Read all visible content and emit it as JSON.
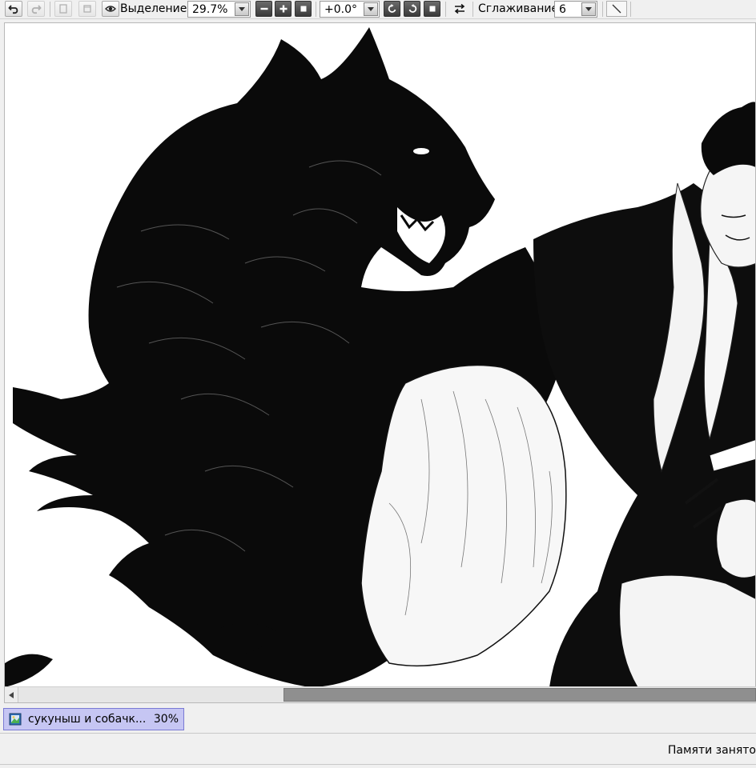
{
  "toolbar": {
    "selection_label": "Выделение",
    "zoom_value": "29.7%",
    "rotation_value": "+0.0°",
    "smoothing_label": "Сглаживание",
    "smoothing_value": "6"
  },
  "document_tab": {
    "name": "сукуныш и собачк...",
    "zoom": "30%"
  },
  "status": {
    "memory_label": "Памяти занято"
  },
  "colors": {
    "tab_active_bg": "#c6c6f3",
    "scroll_thumb": "#8f8f8f",
    "ink": "#000000"
  },
  "icons": [
    "undo-icon",
    "redo-icon",
    "page-icon",
    "view-eye-icon",
    "zoom-out-icon",
    "zoom-in-icon",
    "zoom-reset-icon",
    "rotate-left-icon",
    "rotate-right-icon",
    "rotate-reset-icon",
    "flip-icon",
    "line-tool-icon"
  ]
}
